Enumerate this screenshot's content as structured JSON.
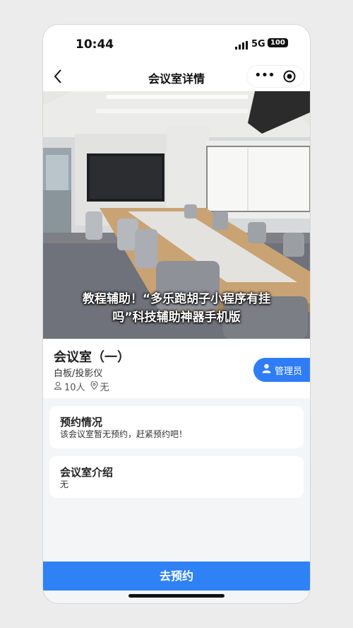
{
  "status": {
    "time": "10:44",
    "network": "5G",
    "battery": "100"
  },
  "nav": {
    "title": "会议室详情",
    "back_icon": "chevron-left-icon",
    "more_icon": "more-dots-icon",
    "target_icon": "target-icon"
  },
  "photo": {
    "watermark_line1": "教程辅助！“多乐跑胡子小程序有挂",
    "watermark_line2": "吗”科技辅助神器手机版"
  },
  "room": {
    "name": "会议室（一）",
    "equipment": "白板/投影仪",
    "capacity": "10人",
    "location": "无",
    "admin_label": "管理员"
  },
  "reservation": {
    "title": "预约情况",
    "text": "该会议室暂无预约，赶紧预约吧！"
  },
  "intro": {
    "title": "会议室介绍",
    "text": "无"
  },
  "bottom": {
    "button_label": "去预约"
  },
  "colors": {
    "accent": "#2f7cf6",
    "page_bg": "#f4f5f7"
  }
}
